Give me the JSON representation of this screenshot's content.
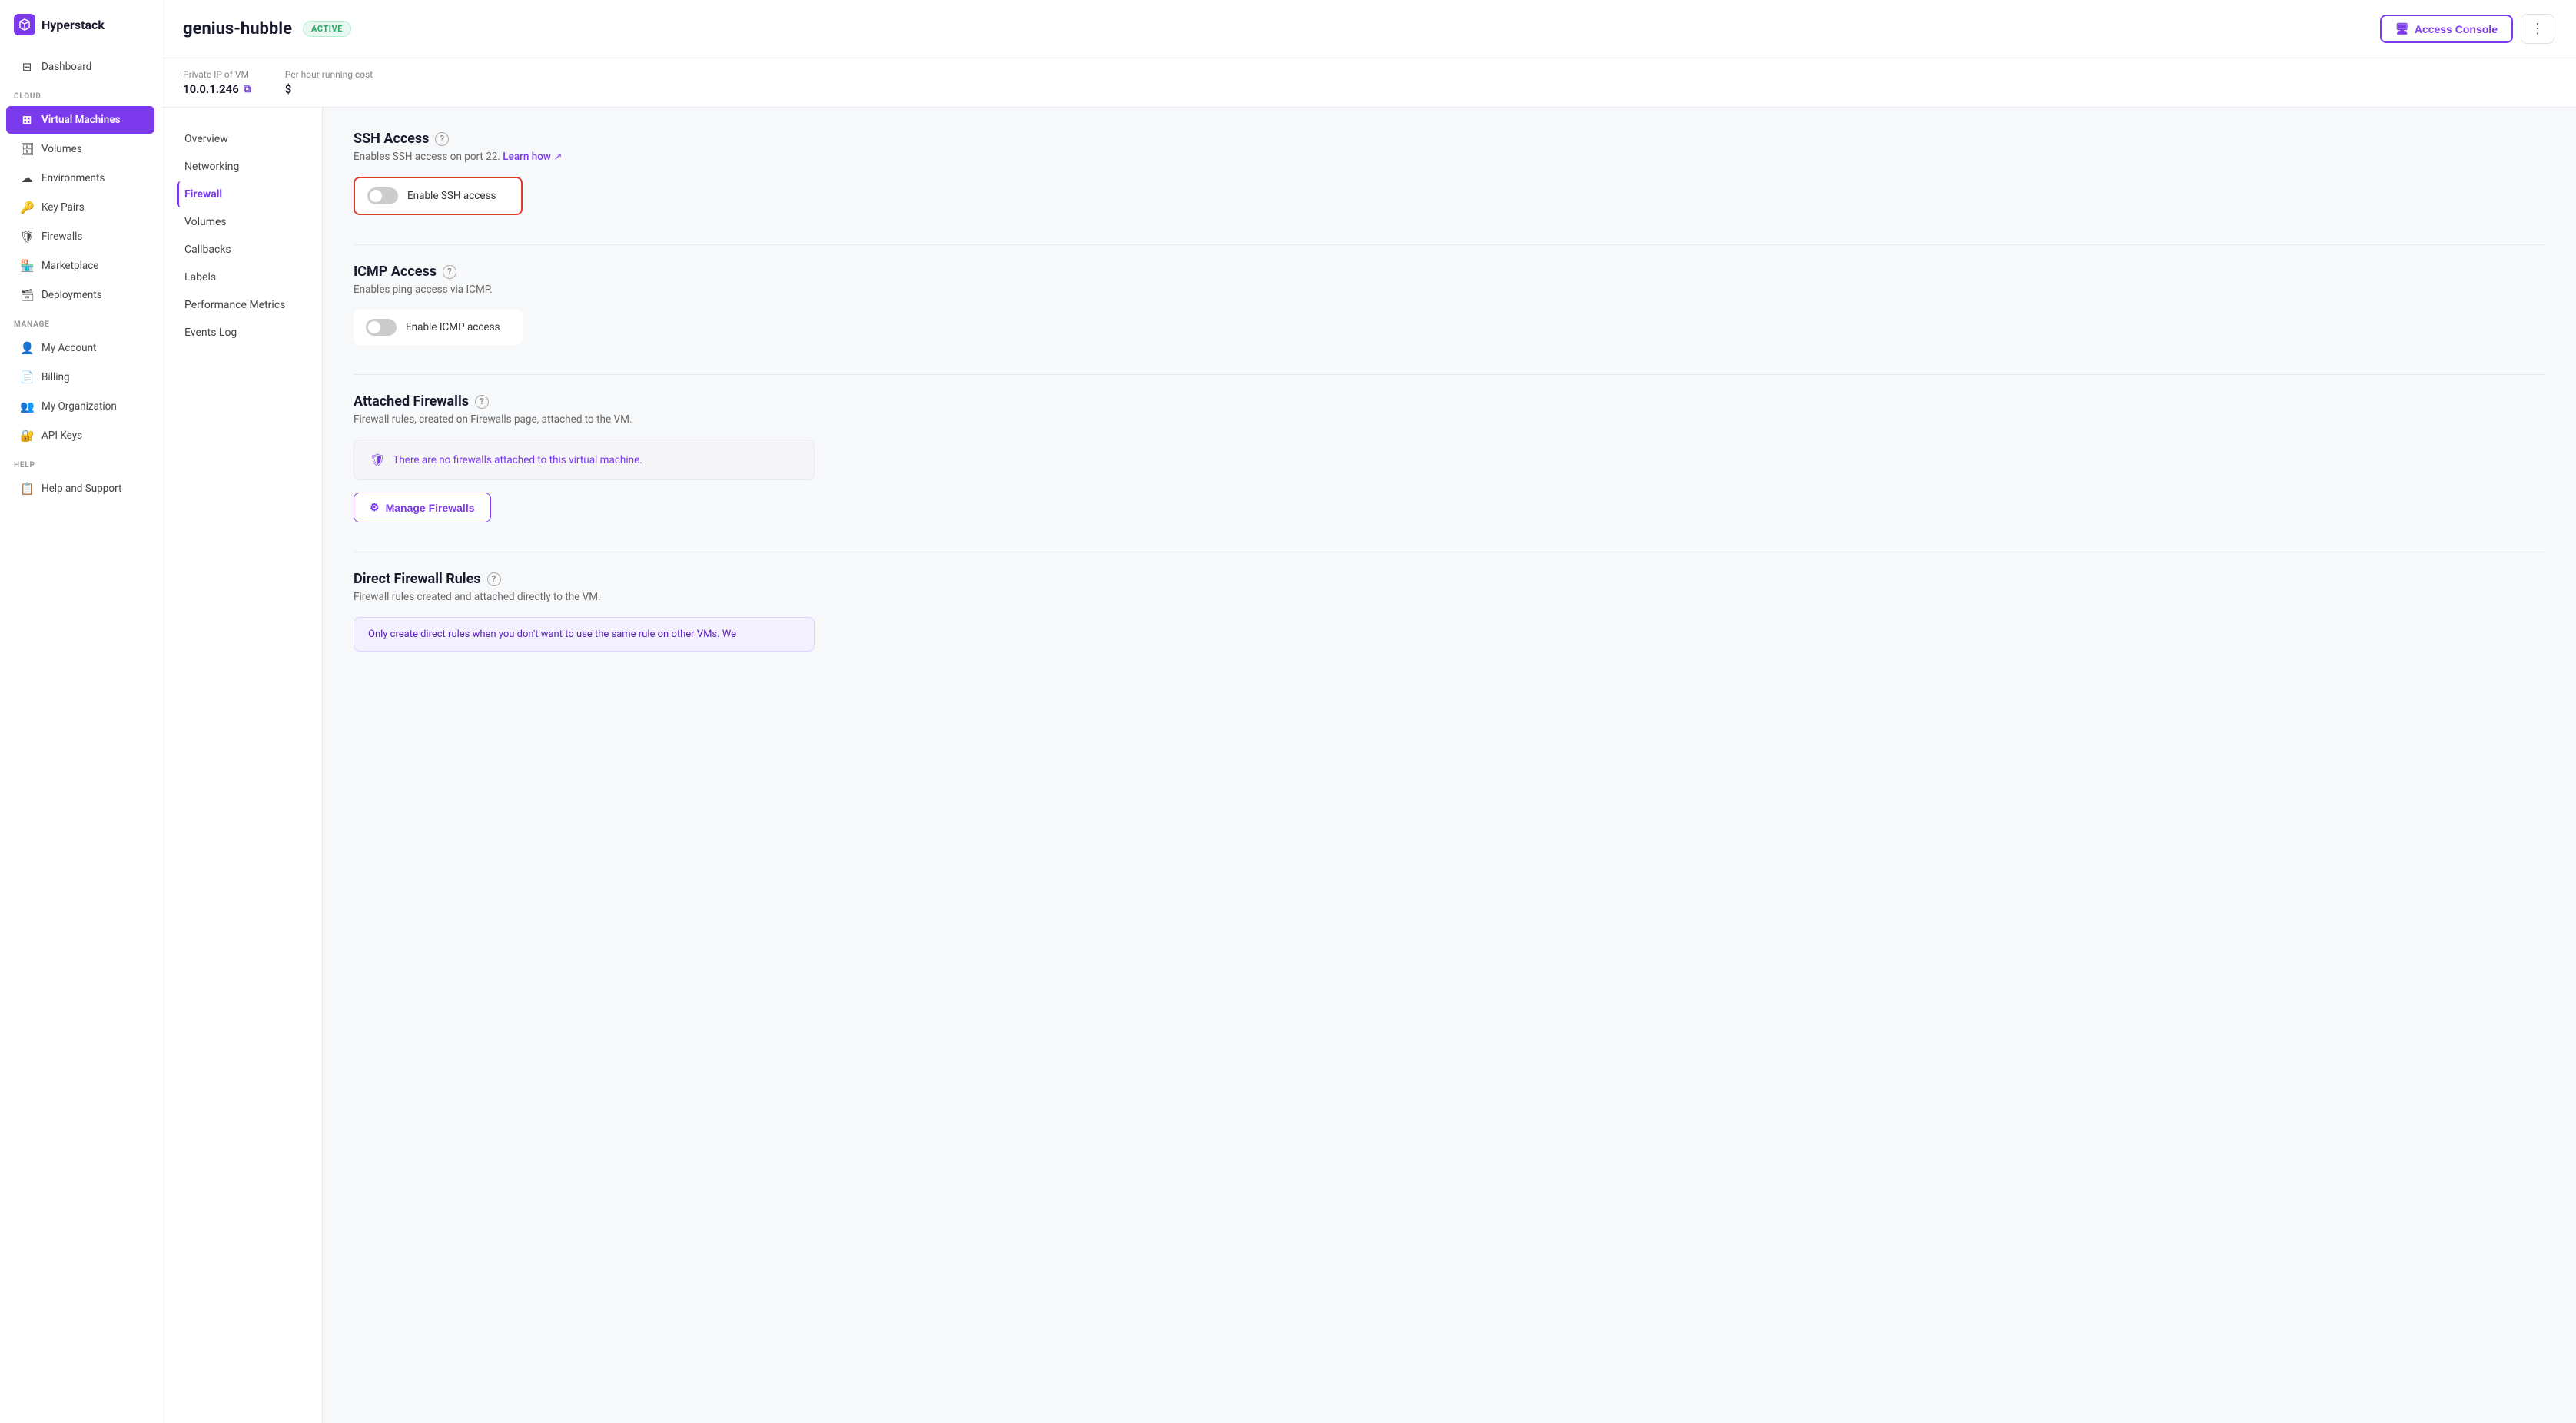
{
  "app": {
    "name": "Hyperstack"
  },
  "sidebar": {
    "dashboard_label": "Dashboard",
    "cloud_section": "CLOUD",
    "cloud_items": [
      {
        "id": "virtual-machines",
        "label": "Virtual Machines",
        "icon": "⊞",
        "active": true
      },
      {
        "id": "volumes",
        "label": "Volumes",
        "icon": "🗄"
      },
      {
        "id": "environments",
        "label": "Environments",
        "icon": "☁"
      },
      {
        "id": "key-pairs",
        "label": "Key Pairs",
        "icon": "🔑"
      },
      {
        "id": "firewalls",
        "label": "Firewalls",
        "icon": "🛡"
      },
      {
        "id": "marketplace",
        "label": "Marketplace",
        "icon": "🏪"
      },
      {
        "id": "deployments",
        "label": "Deployments",
        "icon": "🗃"
      }
    ],
    "manage_section": "MANAGE",
    "manage_items": [
      {
        "id": "my-account",
        "label": "My Account",
        "icon": "👤"
      },
      {
        "id": "billing",
        "label": "Billing",
        "icon": "📄"
      },
      {
        "id": "my-organization",
        "label": "My Organization",
        "icon": "👥"
      },
      {
        "id": "api-keys",
        "label": "API Keys",
        "icon": "🔐"
      }
    ],
    "help_section": "HELP",
    "help_items": [
      {
        "id": "help-support",
        "label": "Help and Support",
        "icon": "📋"
      }
    ]
  },
  "header": {
    "vm_name": "genius-hubble",
    "status": "ACTIVE",
    "private_ip_label": "Private IP of VM",
    "private_ip_value": "10.0.1.246",
    "hourly_cost_label": "Per hour running cost",
    "hourly_cost_value": "$",
    "access_console_label": "Access Console",
    "more_icon": "⋮"
  },
  "side_nav": {
    "items": [
      {
        "id": "overview",
        "label": "Overview",
        "active": false
      },
      {
        "id": "networking",
        "label": "Networking",
        "active": false
      },
      {
        "id": "firewall",
        "label": "Firewall",
        "active": true
      },
      {
        "id": "volumes",
        "label": "Volumes",
        "active": false
      },
      {
        "id": "callbacks",
        "label": "Callbacks",
        "active": false
      },
      {
        "id": "labels",
        "label": "Labels",
        "active": false
      },
      {
        "id": "performance-metrics",
        "label": "Performance Metrics",
        "active": false
      },
      {
        "id": "events-log",
        "label": "Events Log",
        "active": false
      }
    ]
  },
  "firewall_page": {
    "ssh_section": {
      "title": "SSH Access",
      "desc_prefix": "Enables SSH access on port 22.",
      "learn_link_text": "Learn how",
      "toggle_label": "Enable SSH access",
      "toggle_on": false,
      "highlighted": true
    },
    "icmp_section": {
      "title": "ICMP Access",
      "desc": "Enables ping access via ICMP.",
      "toggle_label": "Enable ICMP access",
      "toggle_on": false
    },
    "attached_firewalls": {
      "title": "Attached Firewalls",
      "desc": "Firewall rules, created on Firewalls page, attached to the VM.",
      "empty_message": "There are no firewalls attached to this virtual machine.",
      "manage_btn_label": "Manage Firewalls"
    },
    "direct_rules": {
      "title": "Direct Firewall Rules",
      "desc": "Firewall rules created and attached directly to the VM.",
      "notice": "Only create direct rules when you don't want to use the same rule on other VMs. We"
    }
  }
}
